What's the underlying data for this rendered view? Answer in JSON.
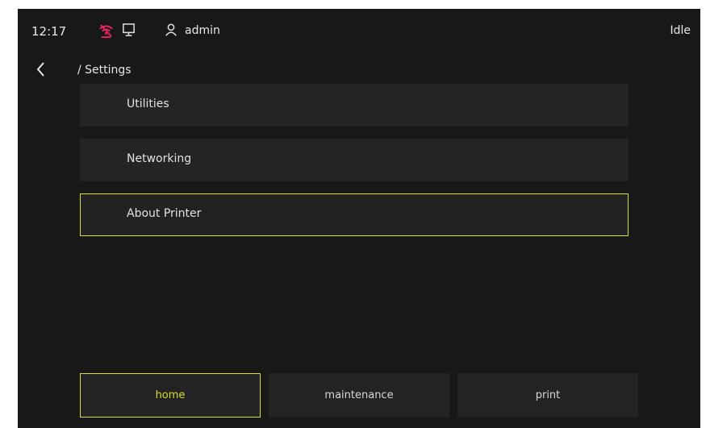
{
  "status_bar": {
    "time": "12:17",
    "network_icon": "network-disconnected-icon",
    "host_icon": "computer-icon",
    "user_icon": "user-icon",
    "username": "admin",
    "state": "Idle"
  },
  "nav": {
    "back_icon": "chevron-left-icon",
    "breadcrumb": "/ Settings"
  },
  "menu": {
    "items": [
      {
        "label": "Utilities"
      },
      {
        "label": "Networking"
      },
      {
        "label": "About Printer"
      }
    ],
    "selected": "About Printer"
  },
  "footer": {
    "tabs": [
      {
        "label": "home"
      },
      {
        "label": "maintenance"
      },
      {
        "label": "print"
      }
    ],
    "active": "home"
  },
  "colors": {
    "background": "#181818",
    "panel": "#242424",
    "accent": "#d6df2a",
    "alert": "#e5265e"
  }
}
